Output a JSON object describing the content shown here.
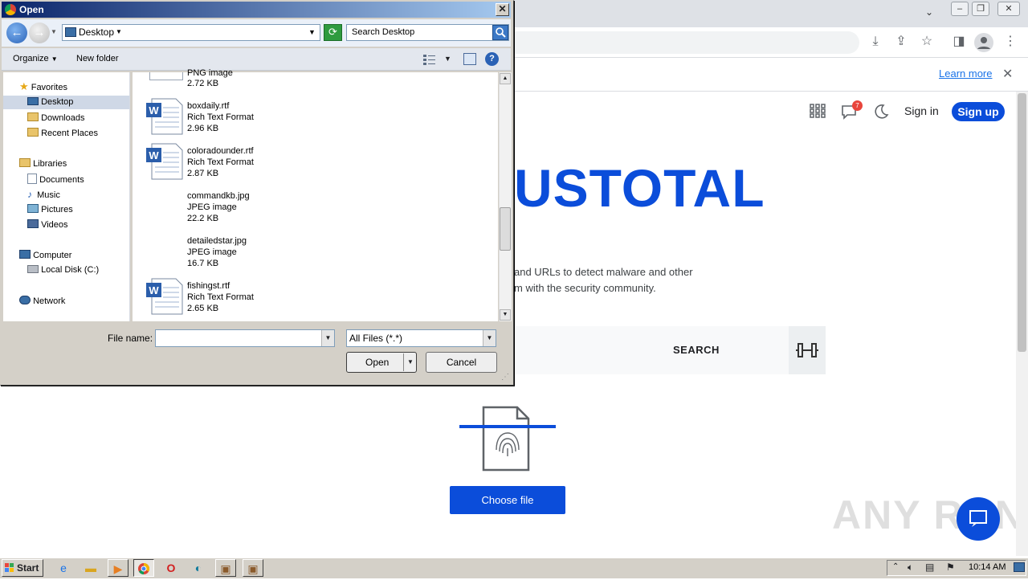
{
  "browser": {
    "infobar": {
      "learn_more": "Learn more"
    },
    "virustotal": {
      "notification_count": "7",
      "sign_in": "Sign in",
      "sign_up": "Sign up",
      "logo_text": "USTOTAL",
      "description_line1": "and URLs to detect malware and other",
      "description_line2": "m with the security community.",
      "search_tab": "SEARCH",
      "choose_file": "Choose file"
    },
    "watermark": "ANY RUN"
  },
  "dialog": {
    "title": "Open",
    "address": {
      "location": "Desktop"
    },
    "search_placeholder": "Search Desktop",
    "toolbar": {
      "organize": "Organize",
      "new_folder": "New folder"
    },
    "nav": {
      "favorites": "Favorites",
      "desktop": "Desktop",
      "downloads": "Downloads",
      "recent_places": "Recent Places",
      "libraries": "Libraries",
      "documents": "Documents",
      "music": "Music",
      "pictures": "Pictures",
      "videos": "Videos",
      "computer": "Computer",
      "local_disk": "Local Disk (C:)",
      "network": "Network"
    },
    "files": [
      {
        "name": "",
        "type": "PNG image",
        "size": "2.72 KB",
        "icon": "image-icon"
      },
      {
        "name": "boxdaily.rtf",
        "type": "Rich Text Format",
        "size": "2.96 KB",
        "icon": "word-doc-icon"
      },
      {
        "name": "coloradounder.rtf",
        "type": "Rich Text Format",
        "size": "2.87 KB",
        "icon": "word-doc-icon"
      },
      {
        "name": "commandkb.jpg",
        "type": "JPEG image",
        "size": "22.2 KB",
        "icon": "image-icon"
      },
      {
        "name": "detailedstar.jpg",
        "type": "JPEG image",
        "size": "16.7 KB",
        "icon": "image-icon"
      },
      {
        "name": "fishingst.rtf",
        "type": "Rich Text Format",
        "size": "2.65 KB",
        "icon": "word-doc-icon"
      }
    ],
    "file_name_label": "File name:",
    "file_name_value": "",
    "filter": "All Files (*.*)",
    "open_button": "Open",
    "cancel_button": "Cancel"
  },
  "taskbar": {
    "start": "Start",
    "clock": "10:14 AM"
  },
  "colors": {
    "vt_blue": "#0b4dda",
    "title_gradient_start": "#0a246a",
    "title_gradient_end": "#a6caf0",
    "dialog_face": "#d4d0c8"
  }
}
